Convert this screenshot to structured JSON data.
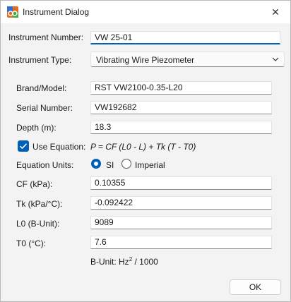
{
  "window": {
    "title": "Instrument Dialog",
    "icon": "instrument-app-icon",
    "close_glyph": "✕"
  },
  "instrument_number": {
    "label": "Instrument Number:",
    "value": "VW 25-01"
  },
  "instrument_type": {
    "label": "Instrument Type:",
    "selected": "Vibrating Wire Piezometer"
  },
  "fields": {
    "brand_model": {
      "label": "Brand/Model:",
      "value": "RST VW2100-0.35-L20"
    },
    "serial_number": {
      "label": "Serial Number:",
      "value": "VW192682"
    },
    "depth": {
      "label": "Depth (m):",
      "value": "18.3"
    }
  },
  "use_equation": {
    "label": "Use Equation:",
    "checked": true,
    "equation": "P = CF (L0 - L) + Tk (T - T0)"
  },
  "equation_units": {
    "label": "Equation Units:",
    "options": [
      "SI",
      "Imperial"
    ],
    "selected": "SI"
  },
  "coefficients": {
    "cf": {
      "label": "CF (kPa):",
      "value": "0.10355"
    },
    "tk": {
      "label": "Tk (kPa/°C):",
      "value": "-0.092422"
    },
    "l0": {
      "label": "L0 (B-Unit):",
      "value": "9089"
    },
    "t0": {
      "label": "T0 (°C):",
      "value": "7.6"
    }
  },
  "b_unit_note": {
    "prefix": "B-Unit: Hz",
    "exponent": "2",
    "suffix": " / 1000"
  },
  "buttons": {
    "ok": "OK"
  },
  "colors": {
    "accent": "#005fb8",
    "window_bg": "#f3f3f3"
  }
}
